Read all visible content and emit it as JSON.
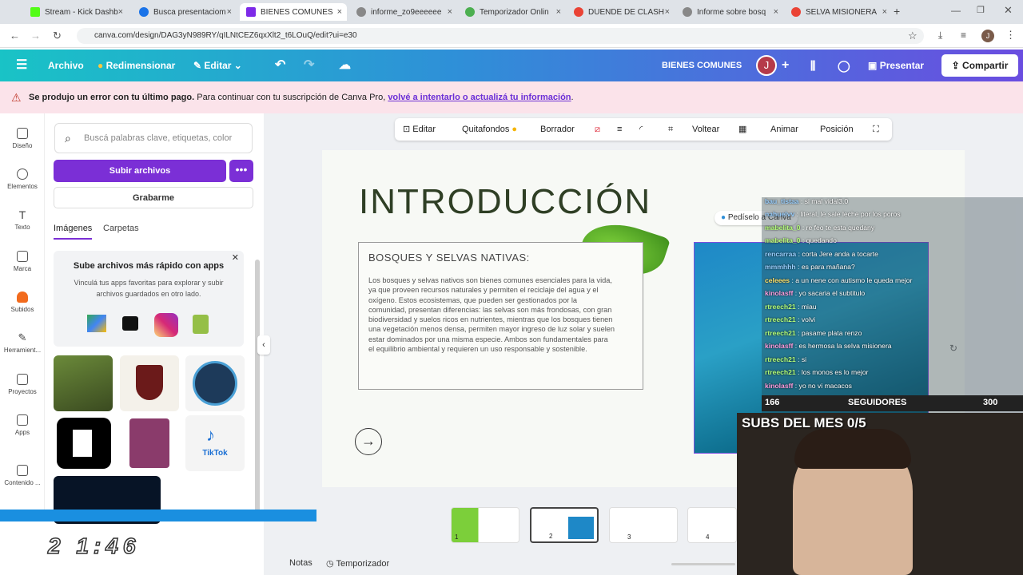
{
  "browser": {
    "tabs": [
      {
        "title": "Stream - Kick Dashb",
        "color": "#53fc18"
      },
      {
        "title": "Busca presentaciom",
        "color": "#1a73e8"
      },
      {
        "title": "BIENES COMUNES",
        "color": "#7d2ae8"
      },
      {
        "title": "informe_zo9eeeeee",
        "color": "#888888"
      },
      {
        "title": "Temporizador Onlin",
        "color": "#4caf50"
      },
      {
        "title": "DUENDE DE CLASH",
        "color": "#ea4335"
      },
      {
        "title": "Informe sobre bosq",
        "color": "#888888"
      },
      {
        "title": "SELVA MISIONERA",
        "color": "#ea4335"
      }
    ],
    "url": "canva.com/design/DAG3yN989RY/qILNtCEZ6qxXlt2_t6LOuQ/edit?ui=e30"
  },
  "canva": {
    "file": "Archivo",
    "resize": "Redimensionar",
    "edit": "Editar",
    "doc_title": "BIENES COMUNES",
    "avatar": "J",
    "present": "Presentar",
    "share": "Compartir"
  },
  "banner": {
    "bold": "Se produjo un error con tu último pago.",
    "text": " Para continuar con tu suscripción de Canva Pro, ",
    "link": "volvé a intentarlo o actualizá tu información",
    "end": "."
  },
  "rail": [
    "Diseño",
    "Elementos",
    "Texto",
    "Marca",
    "Subidos",
    "Herramient...",
    "Proyectos",
    "Apps",
    "Contenido ..."
  ],
  "panel": {
    "search_placeholder": "Buscá palabras clave, etiquetas, color",
    "upload": "Subir archivos",
    "more": "•••",
    "record": "Grabarme",
    "tab_images": "Imágenes",
    "tab_folders": "Carpetas",
    "promo_title": "Sube archivos más rápido con apps",
    "promo_text": "Vinculá tus apps favoritas para explorar y subir archivos guardados en otro lado."
  },
  "floatbar": {
    "edit": "Editar",
    "bg_remover": "Quitafondos",
    "eraser": "Borrador",
    "flip": "Voltear",
    "animate": "Animar",
    "position": "Posición"
  },
  "slide": {
    "title": "INTRODUCCIÓN",
    "heading": "BOSQUES Y SELVAS NATIVAS:",
    "body": "Los bosques y selvas nativos son bienes comunes esenciales para la vida, ya que proveen recursos naturales y permiten el reciclaje del agua y el oxígeno. Estos ecosistemas, que pueden ser gestionados por la comunidad, presentan diferencias: las selvas son más frondosas, con gran biodiversidad y suelos ricos en nutrientes, mientras que los bosques tienen una vegetación menos densa, permiten mayor ingreso de luz solar y suelen estar dominados por una misma especie. Ambos son fundamentales para el equilibrio ambiental y requieren un uso responsable y sostenible.",
    "canva_chip": "Pedíselo a Canva"
  },
  "chat": [
    {
      "user": "bau_tistaa",
      "msg": "si mal vidal3.0",
      "color": "#ffffff"
    },
    {
      "user": "nahuelvv",
      "msg": "literal, le sale leche por los poros",
      "color": "#9ad0ff"
    },
    {
      "user": "mabelita_0",
      "msg": "re feo te esta quedany",
      "color": "#b4ff7a"
    },
    {
      "user": "mabelita_0",
      "msg": "quedando",
      "color": "#b4ff7a"
    },
    {
      "user": "rencarraa",
      "msg": "corta Jere anda a tocarte",
      "color": "#9ad0ff"
    },
    {
      "user": "mmmhhh",
      "msg": "es para mañana?",
      "color": "#9ad0ff"
    },
    {
      "user": "celeees",
      "msg": "a un nene con autismo le queda mejor",
      "color": "#ffe36b"
    },
    {
      "user": "kinolasff",
      "msg": "yo sacaria el subtitulo",
      "color": "#ff9ee0"
    },
    {
      "user": "rtreech21",
      "msg": "miau",
      "color": "#b4ff7a"
    },
    {
      "user": "rtreech21",
      "msg": "volvi",
      "color": "#b4ff7a"
    },
    {
      "user": "rtreech21",
      "msg": "pasame plata renzo",
      "color": "#b4ff7a"
    },
    {
      "user": "kinolasff",
      "msg": "es hermosa la selva misionera",
      "color": "#ff9ee0"
    },
    {
      "user": "rtreech21",
      "msg": "si",
      "color": "#b4ff7a"
    },
    {
      "user": "rtreech21",
      "msg": "los monos es lo mejor",
      "color": "#b4ff7a"
    },
    {
      "user": "kinolasff",
      "msg": "yo no vi macacos",
      "color": "#ff9ee0"
    }
  ],
  "stream": {
    "followers_now": "166",
    "followers_label": "SEGUIDORES",
    "followers_goal": "300",
    "subs": "SUBS DEL MES 0/5"
  },
  "bottom": {
    "clock": "2 1:46",
    "notes": "Notas",
    "timer": "Temporizador",
    "pages": [
      "1",
      "2",
      "3",
      "4"
    ]
  }
}
